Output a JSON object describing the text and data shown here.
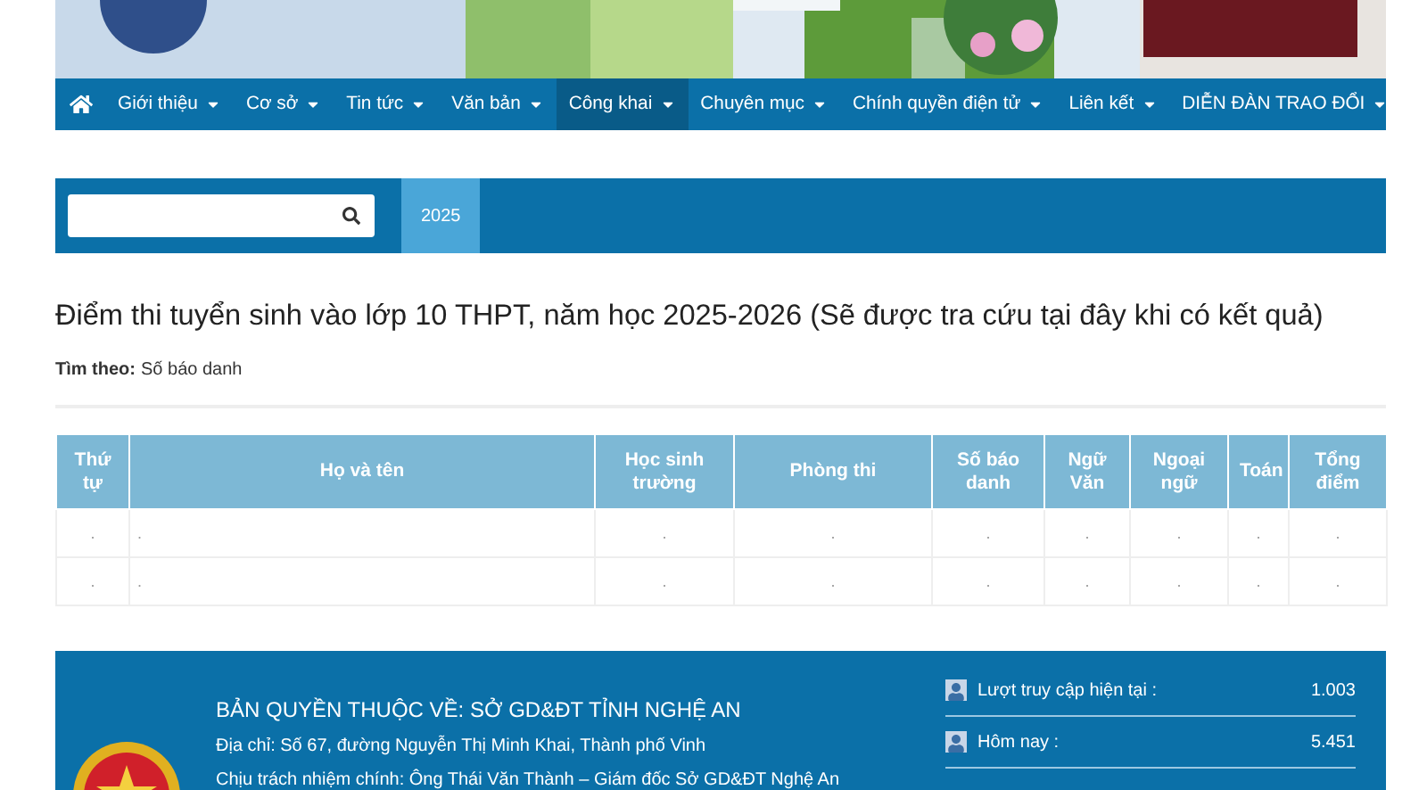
{
  "nav": {
    "items": [
      {
        "label": "Giới thiệu",
        "selected": false
      },
      {
        "label": "Cơ sở",
        "selected": false
      },
      {
        "label": "Tin tức",
        "selected": false
      },
      {
        "label": "Văn bản",
        "selected": false
      },
      {
        "label": "Công khai",
        "selected": true
      },
      {
        "label": "Chuyên mục",
        "selected": false
      },
      {
        "label": "Chính quyền điện tử",
        "selected": false
      },
      {
        "label": "Liên kết",
        "selected": false
      },
      {
        "label": "DIỄN ĐÀN TRAO ĐỔI",
        "selected": false
      }
    ]
  },
  "search": {
    "tabs": [
      {
        "label": "2025",
        "selected": true
      }
    ]
  },
  "title": "Điểm thi tuyển sinh vào lớp 10 THPT, năm học 2025-2026 (Sẽ được tra cứu tại đây khi có kết quả)",
  "filter": {
    "label": "Tìm theo:",
    "value": "Số báo danh"
  },
  "table": {
    "columns": [
      "Thứ tự",
      "Họ và tên",
      "Học sinh trường",
      "Phòng thi",
      "Số báo danh",
      "Ngữ Văn",
      "Ngoại ngữ",
      "Toán",
      "Tổng điểm"
    ],
    "rows": [
      [
        ".",
        ".",
        ".",
        ".",
        ".",
        ".",
        ".",
        ".",
        "."
      ],
      [
        ".",
        ".",
        ".",
        ".",
        ".",
        ".",
        ".",
        ".",
        "."
      ]
    ]
  },
  "footer": {
    "heading": "BẢN QUYỀN THUỘC VỀ: SỞ GD&ĐT TỈNH NGHỆ AN",
    "lines": [
      "Địa chỉ: Số 67, đường Nguyễn Thị Minh Khai, Thành phố Vinh",
      "Chịu trách nhiệm chính: Ông Thái Văn Thành – Giám đốc Sở GD&ĐT Nghệ An"
    ],
    "stats": [
      {
        "label": "Lượt truy cập hiện tại :",
        "value": "1.003"
      },
      {
        "label": "Hôm nay :",
        "value": "5.451"
      }
    ]
  }
}
